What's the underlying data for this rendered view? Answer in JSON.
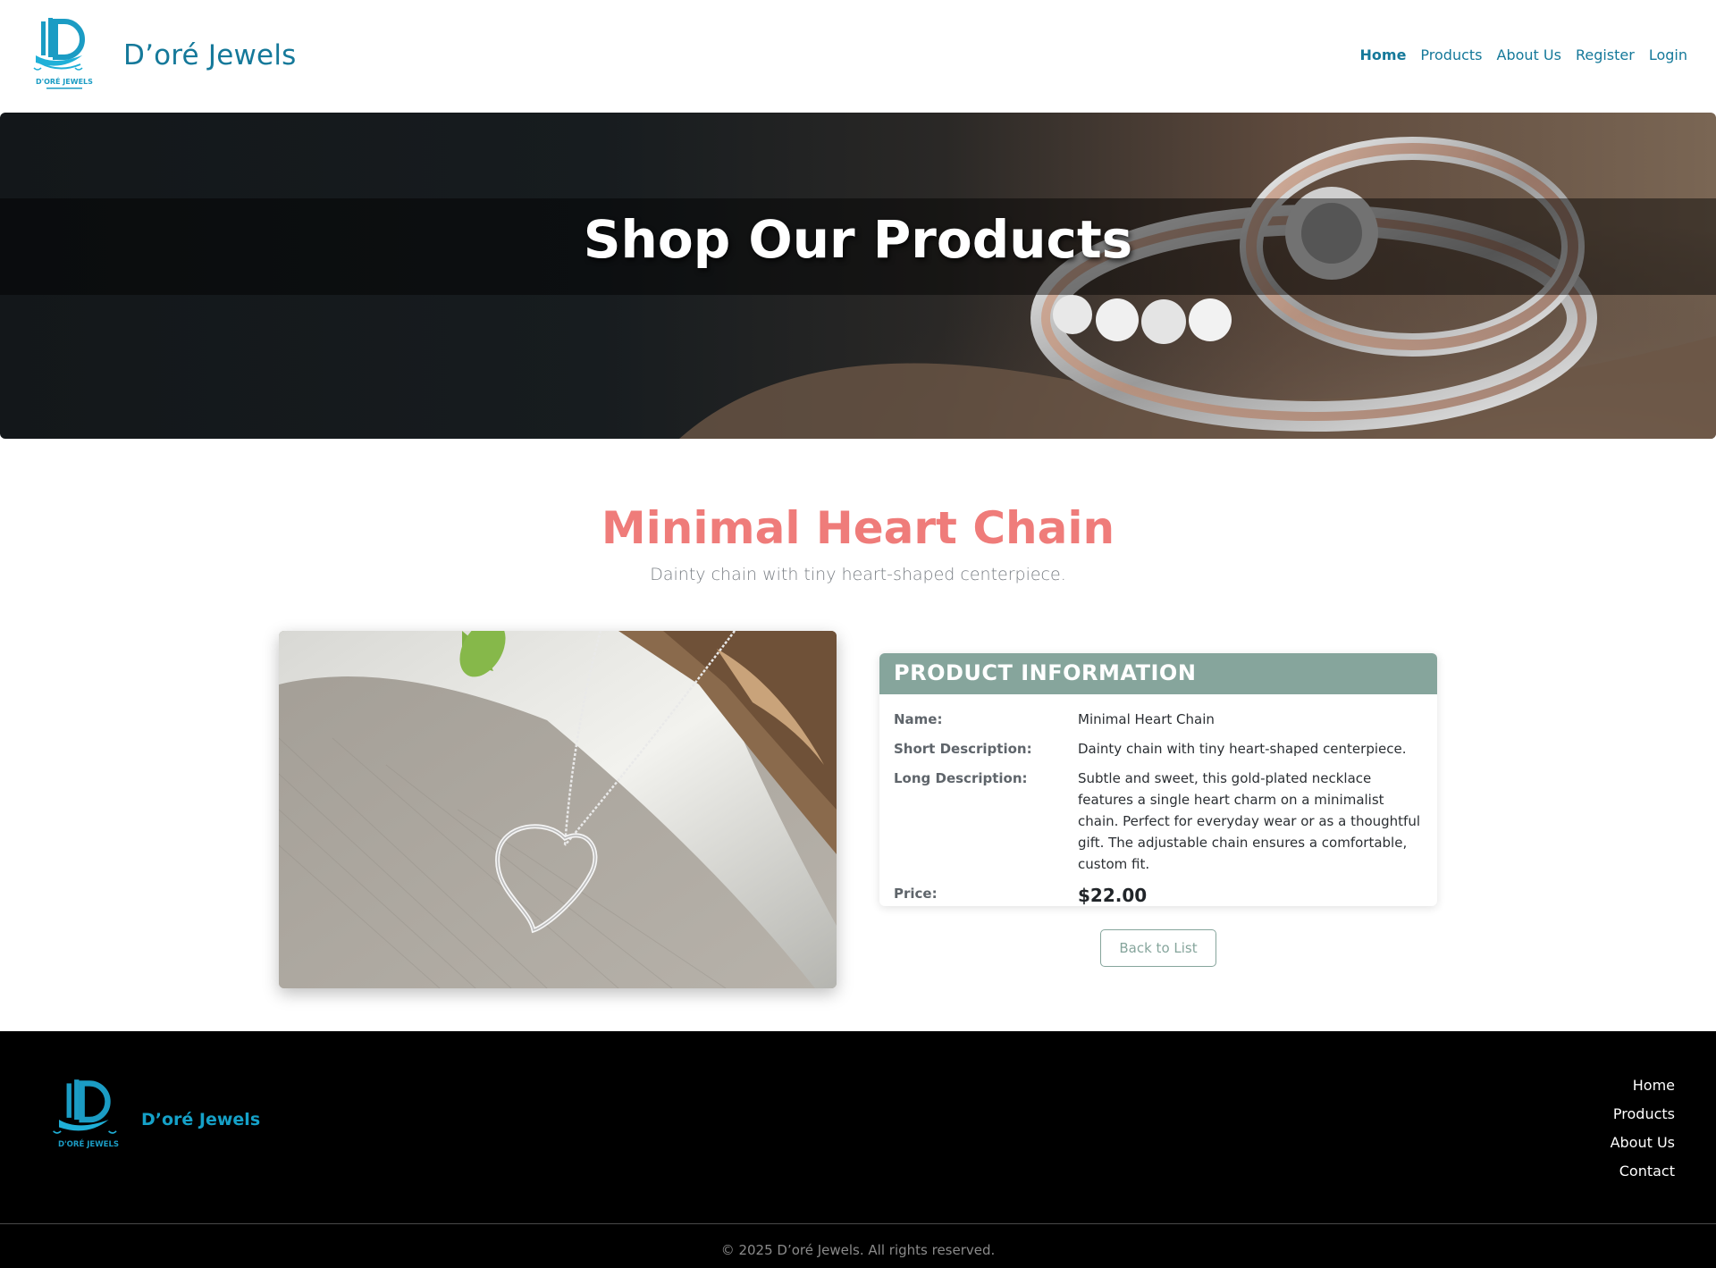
{
  "header": {
    "brand_name": "D’oré Jewels",
    "logo_caption": "D'ORÉ JEWELS",
    "nav": [
      {
        "label": "Home",
        "active": true
      },
      {
        "label": "Products",
        "active": false
      },
      {
        "label": "About Us",
        "active": false
      },
      {
        "label": "Register",
        "active": false
      },
      {
        "label": "Login",
        "active": false
      }
    ]
  },
  "hero": {
    "title": "Shop Our Products"
  },
  "product": {
    "title": "Minimal Heart Chain",
    "subtitle": "Dainty chain with tiny heart-shaped centerpiece.",
    "info_heading": "PRODUCT INFORMATION",
    "fields": {
      "name_label": "Name:",
      "name_value": "Minimal Heart Chain",
      "short_label": "Short Description:",
      "short_value": "Dainty chain with tiny heart-shaped centerpiece.",
      "long_label": "Long Description:",
      "long_value": "Subtle and sweet, this gold-plated necklace features a single heart charm on a minimalist chain. Perfect for everyday wear or as a thoughtful gift. The adjustable chain ensures a comfortable, custom fit.",
      "price_label": "Price:",
      "price_value": "$22.00"
    },
    "back_button": "Back to List"
  },
  "footer": {
    "brand_name": "D’oré Jewels",
    "links": [
      "Home",
      "Products",
      "About Us",
      "Contact"
    ],
    "copyright": "© 2025 D’oré Jewels. All rights reserved."
  },
  "colors": {
    "brand_teal": "#15799a",
    "title_coral": "#ef7c7a",
    "card_header": "#86a59c",
    "footer_bg": "#000000"
  }
}
